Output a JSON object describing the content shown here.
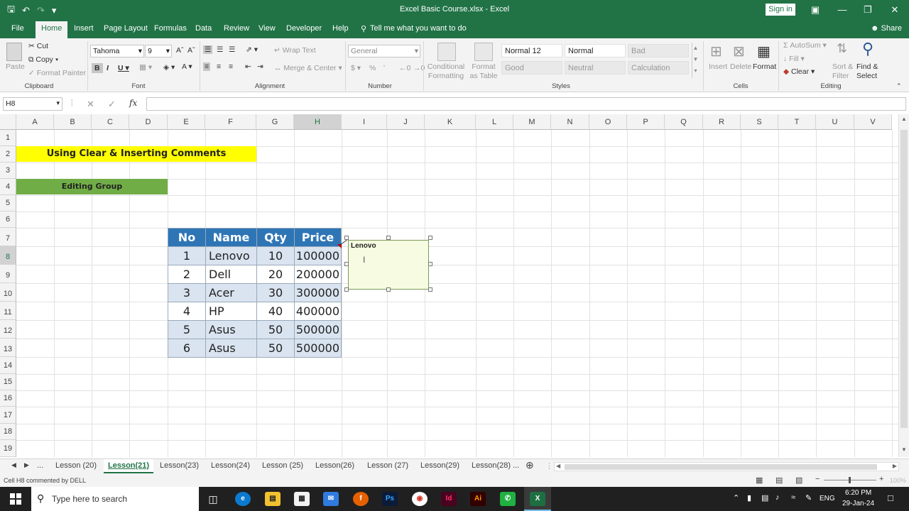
{
  "window": {
    "title": "Excel Basic Course.xlsx  -  Excel",
    "sign_in": "Sign in",
    "share": "Share"
  },
  "menu": {
    "tabs": [
      "File",
      "Home",
      "Insert",
      "Page Layout",
      "Formulas",
      "Data",
      "Review",
      "View",
      "Developer",
      "Help"
    ],
    "active_tab": "Home",
    "tell_me": "Tell me what you want to do"
  },
  "ribbon": {
    "clipboard": {
      "label": "Clipboard",
      "paste": "Paste",
      "cut": "Cut",
      "copy": "Copy",
      "format_painter": "Format Painter"
    },
    "font": {
      "label": "Font",
      "name": "Tahoma",
      "size": "9"
    },
    "alignment": {
      "label": "Alignment",
      "wrap_text": "Wrap Text",
      "merge_center": "Merge & Center"
    },
    "number": {
      "label": "Number",
      "format": "General"
    },
    "styles": {
      "label": "Styles",
      "conditional_formatting": "Conditional Formatting",
      "format_as_table": "Format as Table",
      "cells": [
        "Normal 12",
        "Normal",
        "Bad",
        "Good",
        "Neutral",
        "Calculation"
      ]
    },
    "cells": {
      "label": "Cells",
      "insert": "Insert",
      "delete": "Delete",
      "format": "Format"
    },
    "editing": {
      "label": "Editing",
      "autosum": "AutoSum",
      "fill": "Fill",
      "clear": "Clear",
      "sort_filter": "Sort & Filter",
      "find_select": "Find & Select"
    }
  },
  "formula_bar": {
    "name_box": "H8",
    "fx": "fx",
    "formula": ""
  },
  "sheet": {
    "columns": [
      "A",
      "B",
      "C",
      "D",
      "E",
      "F",
      "G",
      "H",
      "I",
      "J",
      "K",
      "L",
      "M",
      "N",
      "O",
      "P",
      "Q",
      "R",
      "S",
      "T",
      "U",
      "V"
    ],
    "rows": [
      "1",
      "2",
      "3",
      "4",
      "5",
      "6",
      "7",
      "8",
      "9",
      "10",
      "11",
      "12",
      "13",
      "14",
      "15",
      "16",
      "17",
      "18",
      "19"
    ],
    "title_banner": "Using Clear & Inserting Comments",
    "subtitle_banner": "Editing Group",
    "title_color": "#ffff00",
    "subtitle_color": "#70ad47",
    "table_header_color": "#2e75b6",
    "table": {
      "headers": [
        "No",
        "Name",
        "Qty",
        "Price"
      ],
      "rows": [
        [
          "1",
          "Lenovo",
          "10",
          "100000"
        ],
        [
          "2",
          "Dell",
          "20",
          "200000"
        ],
        [
          "3",
          "Acer",
          "30",
          "300000"
        ],
        [
          "4",
          "HP",
          "40",
          "400000"
        ],
        [
          "5",
          "Asus",
          "50",
          "500000"
        ],
        [
          "6",
          "Asus",
          "50",
          "500000"
        ]
      ]
    },
    "comment_text": "Lenovo"
  },
  "sheet_tabs": [
    "Lesson (20)",
    "Lesson(21)",
    "Lesson(23)",
    "Lesson(24)",
    "Lesson (25)",
    "Lesson(26)",
    "Lesson (27)",
    "Lesson(29)",
    "Lesson(28)"
  ],
  "active_sheet": "Lesson(21)",
  "status": {
    "message": "Cell H8 commented by DELL",
    "zoom": "100%"
  },
  "taskbar": {
    "search_placeholder": "Type here to search",
    "language": "ENG",
    "time": "6:20 PM",
    "date": "29-Jan-24"
  }
}
